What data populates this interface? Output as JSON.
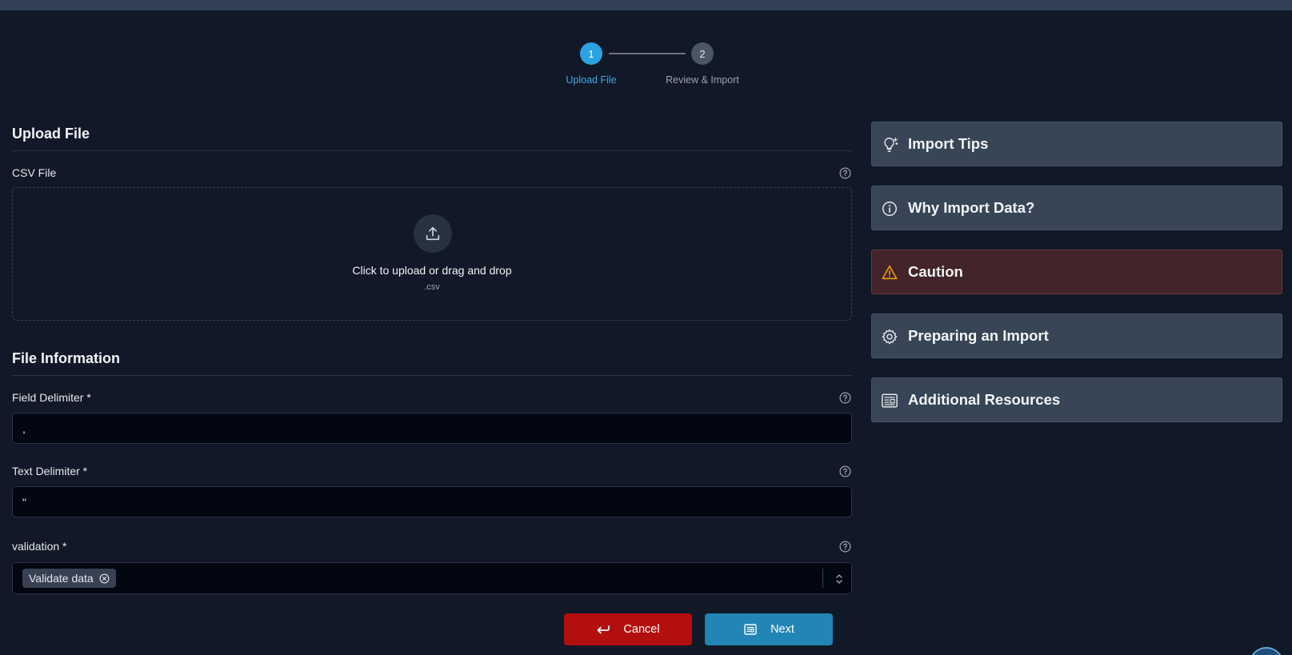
{
  "stepper": {
    "steps": [
      {
        "number": "1",
        "label": "Upload File"
      },
      {
        "number": "2",
        "label": "Review & Import"
      }
    ]
  },
  "upload_section": {
    "title": "Upload File",
    "csv_label": "CSV File",
    "dropzone_text": "Click to upload or drag and drop",
    "dropzone_ext": ".csv"
  },
  "file_info": {
    "title": "File Information",
    "field_delimiter": {
      "label": "Field Delimiter *",
      "value": ","
    },
    "text_delimiter": {
      "label": "Text Delimiter *",
      "value": "\""
    },
    "validation": {
      "label": "validation *",
      "selected": "Validate data"
    }
  },
  "actions": {
    "cancel_label": "Cancel",
    "next_label": "Next"
  },
  "sidebar": {
    "items": [
      {
        "label": "Import Tips",
        "icon": "lightbulb-icon"
      },
      {
        "label": "Why Import Data?",
        "icon": "info-icon"
      },
      {
        "label": "Caution",
        "icon": "warning-icon"
      },
      {
        "label": "Preparing an Import",
        "icon": "gear-icon"
      },
      {
        "label": "Additional Resources",
        "icon": "newspaper-icon"
      }
    ]
  },
  "colors": {
    "background": "#111827",
    "accent": "#2ba3e3",
    "cancel": "#b40f0f",
    "next": "#2185b5",
    "caution_bg": "#42242a"
  }
}
